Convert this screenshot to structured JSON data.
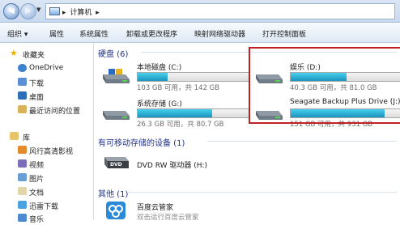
{
  "address": {
    "path": "计算机",
    "separator": "▸"
  },
  "toolbar": {
    "organize": "组织 ▾",
    "properties": "属性",
    "system_properties": "系统属性",
    "uninstall": "卸载或更改程序",
    "map_drive": "映射网络驱动器",
    "control_panel": "打开控制面板"
  },
  "nav": {
    "favorites": "收藏夹",
    "onedrive": "OneDrive",
    "downloads": "下载",
    "desktop": "桌面",
    "recent": "最近访问的位置",
    "libraries": "库",
    "lib_fengxing": "风行高清影视",
    "lib_video": "视频",
    "lib_pictures": "图片",
    "lib_documents": "文档",
    "lib_xunlei": "迅雷下载",
    "lib_music": "音乐"
  },
  "groups": {
    "hard_disks": "硬盘 (6)",
    "removable": "有可移动存储的设备 (1)",
    "other": "其他 (1)"
  },
  "drives": {
    "c": {
      "name": "本地磁盘 (C:)",
      "free": "103 GB 可用，共 142 GB",
      "used_fraction": 0.27
    },
    "d": {
      "name": "娱乐 (D:)",
      "free": "40.3 GB 可用，共 81.0 GB",
      "used_fraction": 0.5
    },
    "g": {
      "name": "系统存储 (G:)",
      "free": "26.3 GB 可用，共 80.7 GB",
      "used_fraction": 0.67
    },
    "j": {
      "name": "Seagate Backup Plus Drive (J:)",
      "free": "151 GB 可用，共 931 GB",
      "used_fraction": 0.84
    }
  },
  "dvd": {
    "name": "DVD RW 驱动器 (H:)",
    "badge": "DVD"
  },
  "other_item": {
    "name": "百度云管家",
    "sub": "双击运行百度云管家"
  },
  "colors": {
    "highlight_border": "#c12025",
    "bar_fill": "#26a8d4"
  }
}
